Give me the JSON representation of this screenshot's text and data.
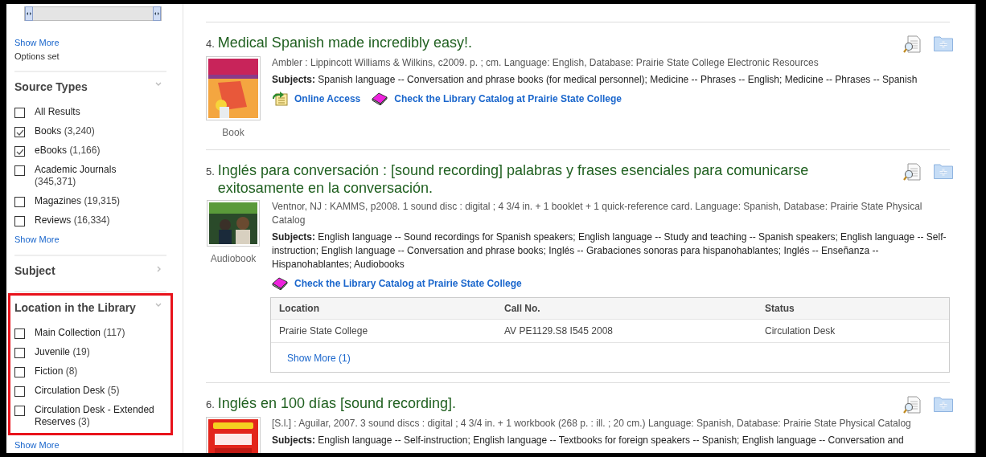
{
  "sidebar": {
    "range_slider": {
      "handles": [
        {
          "level": 0
        },
        {
          "level": 1
        }
      ]
    },
    "show_more": "Show More",
    "options_note": "Options set",
    "facets": [
      {
        "title": "Source Types",
        "expanded": true,
        "highlighted": false,
        "options": [
          {
            "label": "All Results",
            "checked": false
          },
          {
            "label": "Books",
            "count": "(3,240)",
            "checked": true
          },
          {
            "label": "eBooks",
            "count": "(1,166)",
            "checked": true
          },
          {
            "label": "Academic Journals",
            "count": "(345,371)",
            "checked": false
          },
          {
            "label": "Magazines",
            "count": "(19,315)",
            "checked": false
          },
          {
            "label": "Reviews",
            "count": "(16,334)",
            "checked": false
          }
        ],
        "show_more": "Show More"
      },
      {
        "title": "Subject",
        "expanded": false,
        "highlighted": false
      },
      {
        "title": "Location in the Library",
        "expanded": true,
        "highlighted": true,
        "options": [
          {
            "label": "Main Collection",
            "count": "(117)",
            "checked": false
          },
          {
            "label": "Juvenile",
            "count": "(19)",
            "checked": false
          },
          {
            "label": "Fiction",
            "count": "(8)",
            "checked": false
          },
          {
            "label": "Circulation Desk",
            "count": "(5)",
            "checked": false
          },
          {
            "label": "Circulation Desk - Extended Reserves",
            "count": "(3)",
            "checked": false
          }
        ],
        "show_more": "Show More"
      }
    ]
  },
  "results": [
    {
      "number": "4.",
      "title": "Medical Spanish made incredibly easy!.",
      "meta": "Ambler : Lippincott Williams & Wilkins, c2009. p. ; cm. Language: English, Database: Prairie State College Electronic Resources",
      "subjects_label": "Subjects:",
      "subjects": "Spanish language -- Conversation and phrase books (for medical personnel); Medicine -- Phrases -- English; Medicine -- Phrases -- Spanish",
      "format": "Book",
      "links": [
        {
          "kind": "online",
          "label": "Online Access"
        },
        {
          "kind": "catalog",
          "label": "Check the Library Catalog at Prairie State College"
        }
      ]
    },
    {
      "number": "5.",
      "title": "Inglés para conversación : [sound recording] palabras y frases esenciales para comunicarse exitosamente en la conversación.",
      "meta": "Ventnor, NJ : KAMMS, p2008. 1 sound disc : digital ; 4 3/4 in. + 1 booklet + 1 quick-reference card. Language: Spanish, Database: Prairie State Physical Catalog",
      "subjects_label": "Subjects:",
      "subjects": "English language -- Sound recordings for Spanish speakers; English language -- Study and teaching -- Spanish speakers; English language -- Self-instruction; English language -- Conversation and phrase books; Inglés -- Grabaciones sonoras para hispanohablantes; Inglés -- Enseñanza -- Hispanohablantes; Audiobooks",
      "format": "Audiobook",
      "links": [
        {
          "kind": "catalog",
          "label": "Check the Library Catalog at Prairie State College"
        }
      ],
      "holdings": {
        "columns": [
          "Location",
          "Call No.",
          "Status"
        ],
        "rows": [
          [
            "Prairie State College",
            "AV PE1129.S8 I545 2008",
            "Circulation Desk"
          ]
        ],
        "show_more": "Show More (1)"
      }
    },
    {
      "number": "6.",
      "title": "Inglés en 100 días [sound recording].",
      "meta": "[S.l.] : Aguilar, 2007. 3 sound discs : digital ; 4 3/4 in. + 1 workbook (268 p. : ill. ; 20 cm.) Language: Spanish, Database: Prairie State Physical Catalog",
      "subjects_label": "Subjects:",
      "subjects": "English language -- Self-instruction; English language -- Textbooks for foreign speakers -- Spanish; English language -- Conversation and"
    }
  ]
}
